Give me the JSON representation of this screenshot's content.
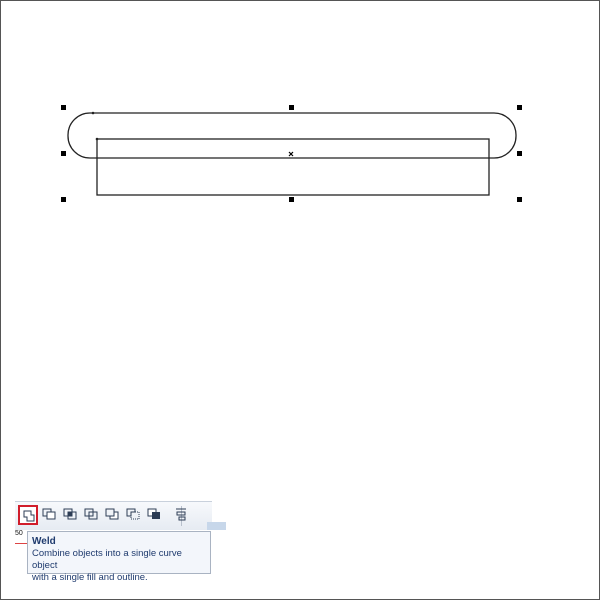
{
  "toolbar": {
    "buttons": [
      {
        "name": "weld",
        "icon": "weld-icon",
        "active": true
      },
      {
        "name": "trim",
        "icon": "trim-icon",
        "active": false
      },
      {
        "name": "intersect",
        "icon": "intersect-icon",
        "active": false
      },
      {
        "name": "simplify",
        "icon": "simplify-icon",
        "active": false
      },
      {
        "name": "front-minus-back",
        "icon": "front-minus-back-icon",
        "active": false
      },
      {
        "name": "back-minus-front",
        "icon": "back-minus-front-icon",
        "active": false
      },
      {
        "name": "create-boundary",
        "icon": "create-boundary-icon",
        "active": false
      },
      {
        "name": "align",
        "icon": "align-icon",
        "active": false
      }
    ],
    "active_color": "#d11d2b"
  },
  "ruler_stub": {
    "text": "50"
  },
  "tooltip": {
    "title": "Weld",
    "description_line1": "Combine objects into a single curve object",
    "description_line2": "with a single fill and outline."
  }
}
